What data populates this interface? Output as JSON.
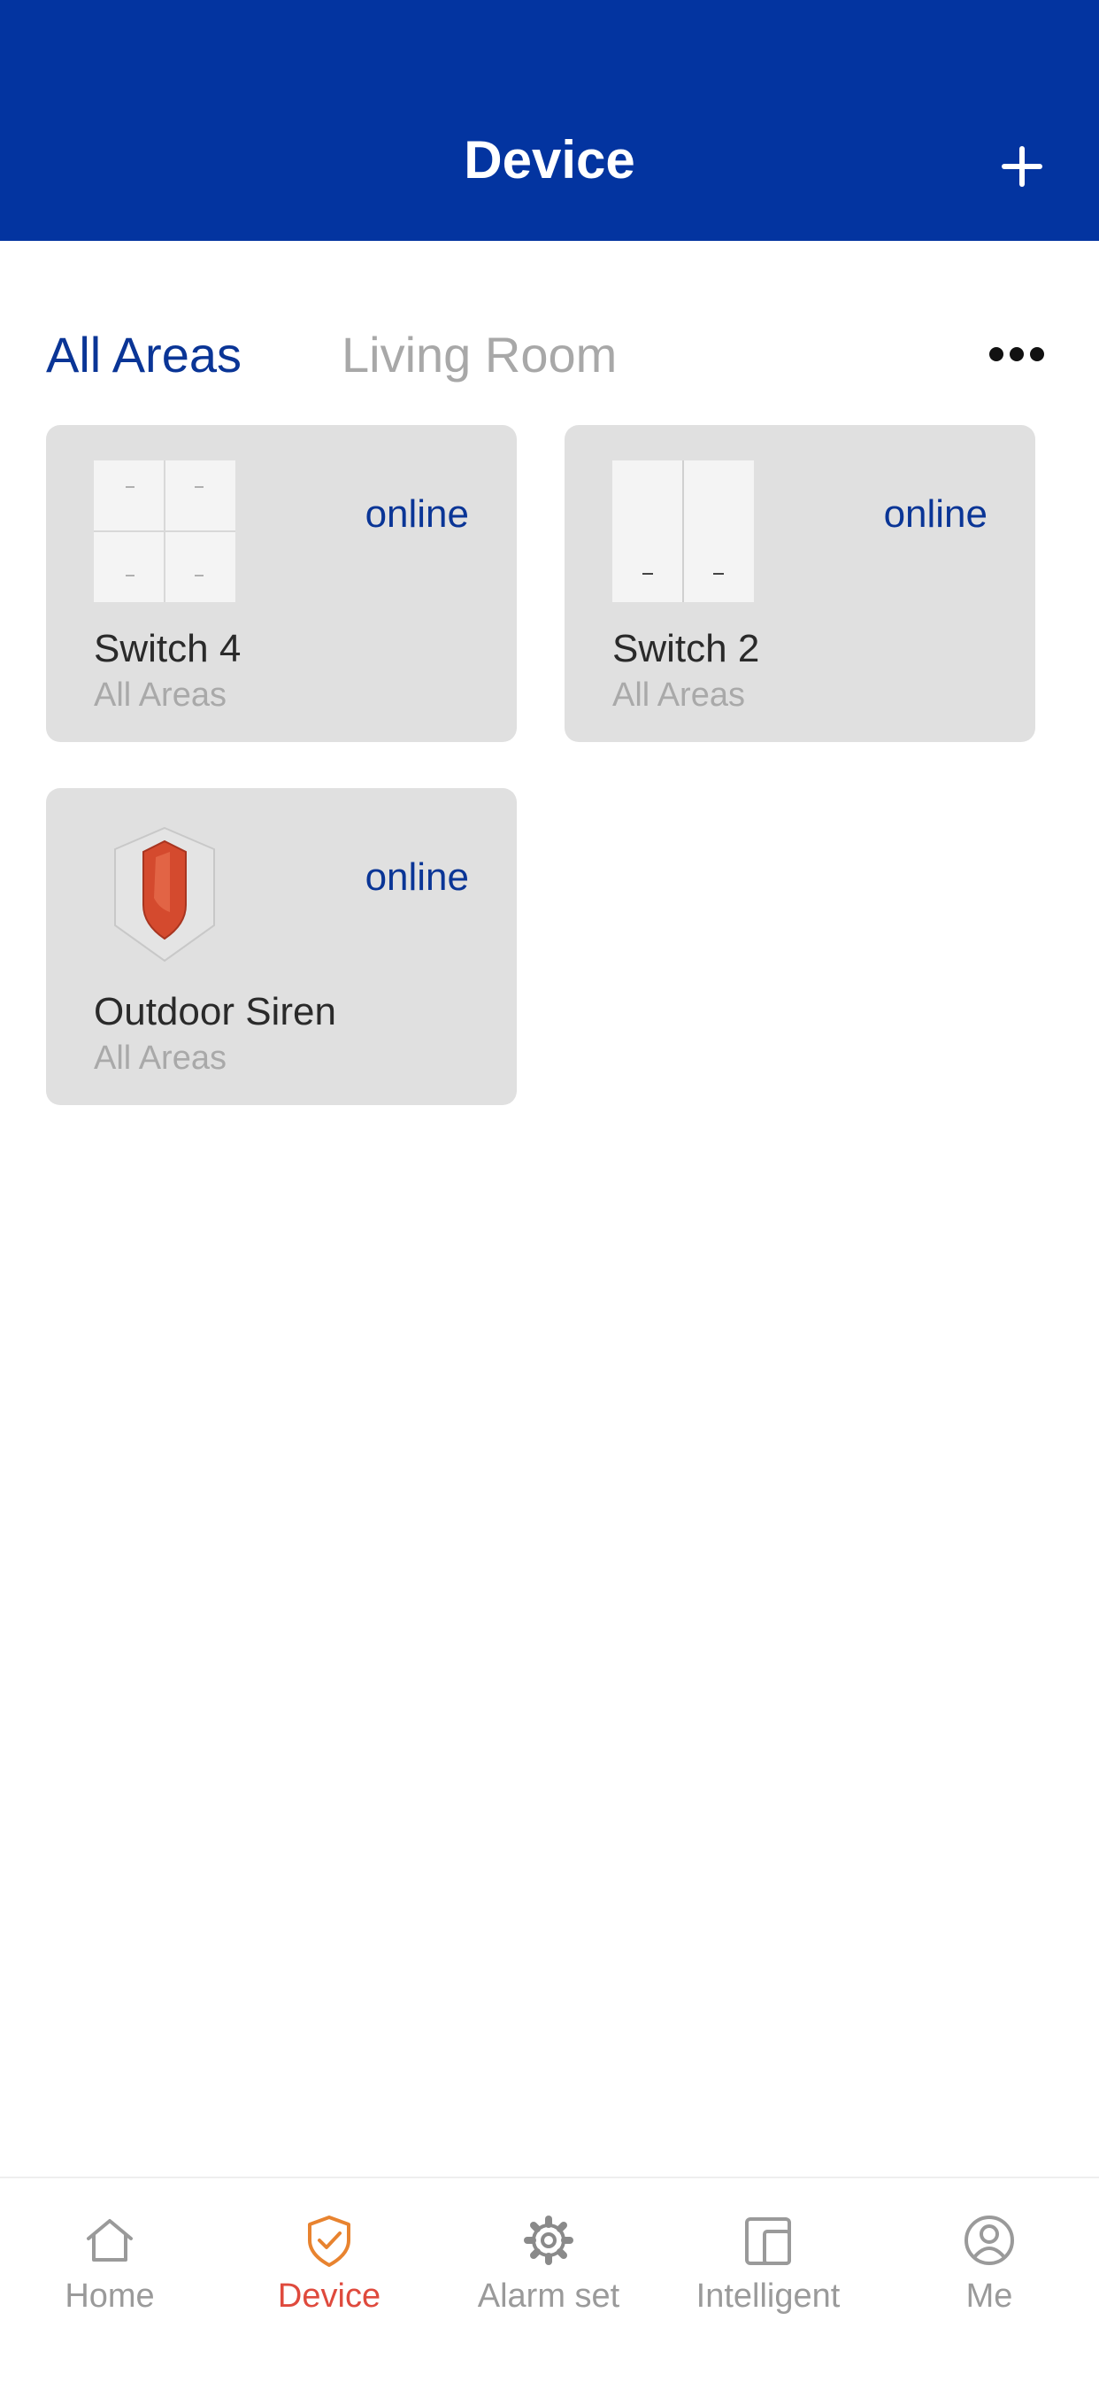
{
  "header": {
    "title": "Device",
    "add_icon": "plus-icon"
  },
  "tabs": [
    {
      "label": "All Areas",
      "active": true
    },
    {
      "label": "Living Room",
      "active": false
    }
  ],
  "more_icon": "more-horizontal-icon",
  "devices": [
    {
      "name": "Switch 4",
      "area": "All Areas",
      "status": "online",
      "icon": "switch-4-gang-icon"
    },
    {
      "name": "Switch 2",
      "area": "All Areas",
      "status": "online",
      "icon": "switch-2-gang-icon"
    },
    {
      "name": "Outdoor Siren",
      "area": "All Areas",
      "status": "online",
      "icon": "siren-shield-icon"
    }
  ],
  "nav": [
    {
      "label": "Home",
      "icon": "home-icon",
      "active": false
    },
    {
      "label": "Device",
      "icon": "shield-check-icon",
      "active": true
    },
    {
      "label": "Alarm set",
      "icon": "gear-icon",
      "active": false
    },
    {
      "label": "Intelligent",
      "icon": "devices-icon",
      "active": false
    },
    {
      "label": "Me",
      "icon": "user-icon",
      "active": false
    }
  ],
  "colors": {
    "header_bg": "#0334a0",
    "accent_blue": "#0a3596",
    "active_nav": "#df4a3d",
    "active_icon": "#e8832f",
    "card_bg": "#e0e0e0"
  }
}
